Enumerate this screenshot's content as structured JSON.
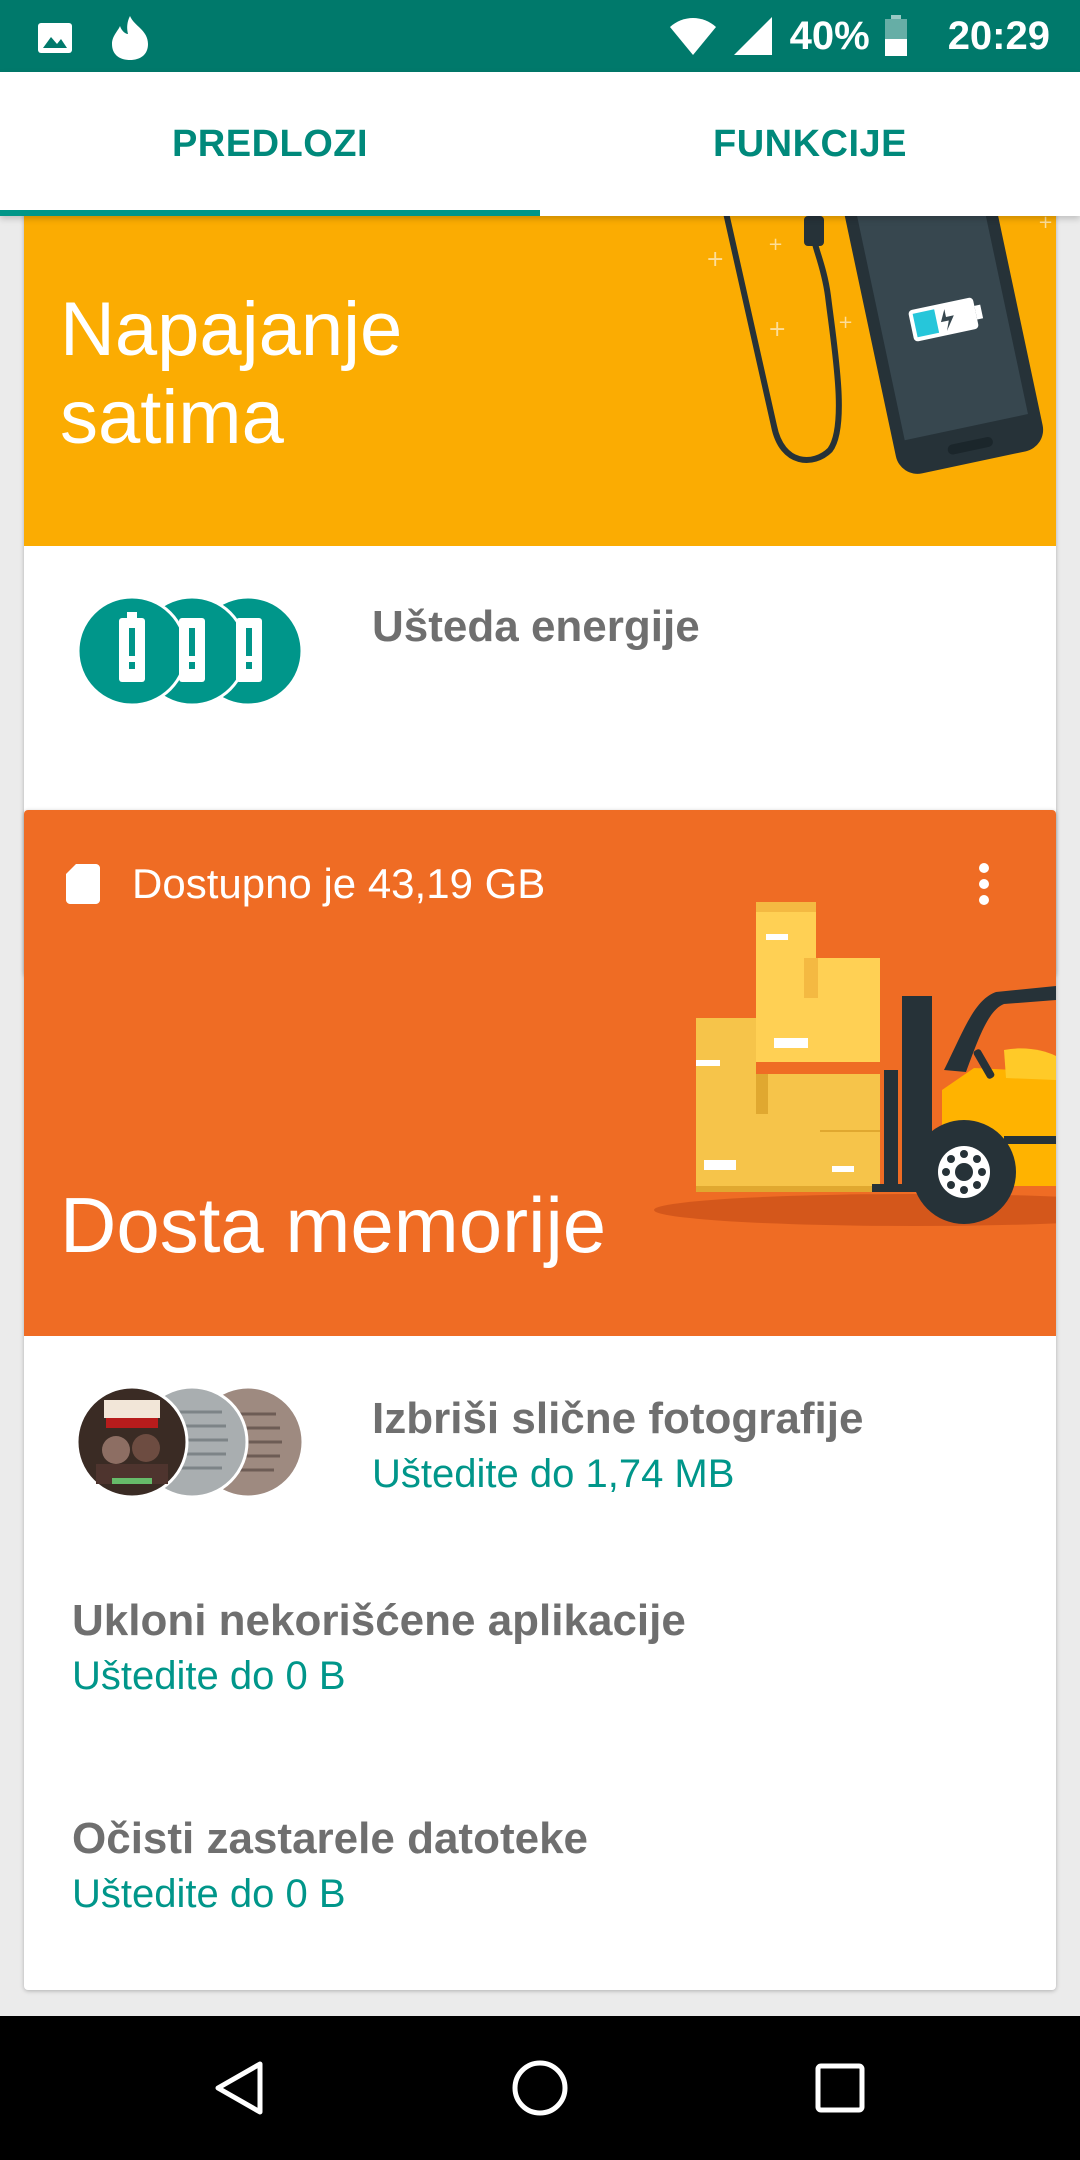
{
  "status_bar": {
    "battery_percent": "40%",
    "time": "20:29"
  },
  "tabs": [
    {
      "label": "PREDLOZI",
      "selected": true
    },
    {
      "label": "FUNKCIJE",
      "selected": false
    }
  ],
  "battery_card": {
    "title_line1": "Napajanje",
    "title_line2": "satima",
    "action_title": "Ušteda energije",
    "hero_color": "#fbac02"
  },
  "storage_card": {
    "available": "Dostupno je 43,19 GB",
    "title": "Dosta memorije",
    "hero_color": "#ef6c24",
    "items": [
      {
        "title": "Izbriši slične fotografije",
        "subtitle": "Uštedite do 1,74 MB"
      },
      {
        "title": "Ukloni nekorišćene aplikacije",
        "subtitle": "Uštedite do 0 B"
      },
      {
        "title": "Očisti zastarele datoteke",
        "subtitle": "Uštedite do 0 B"
      }
    ]
  },
  "colors": {
    "status_bar": "#00796b",
    "accent": "#009688",
    "nav_bar": "#000000"
  }
}
